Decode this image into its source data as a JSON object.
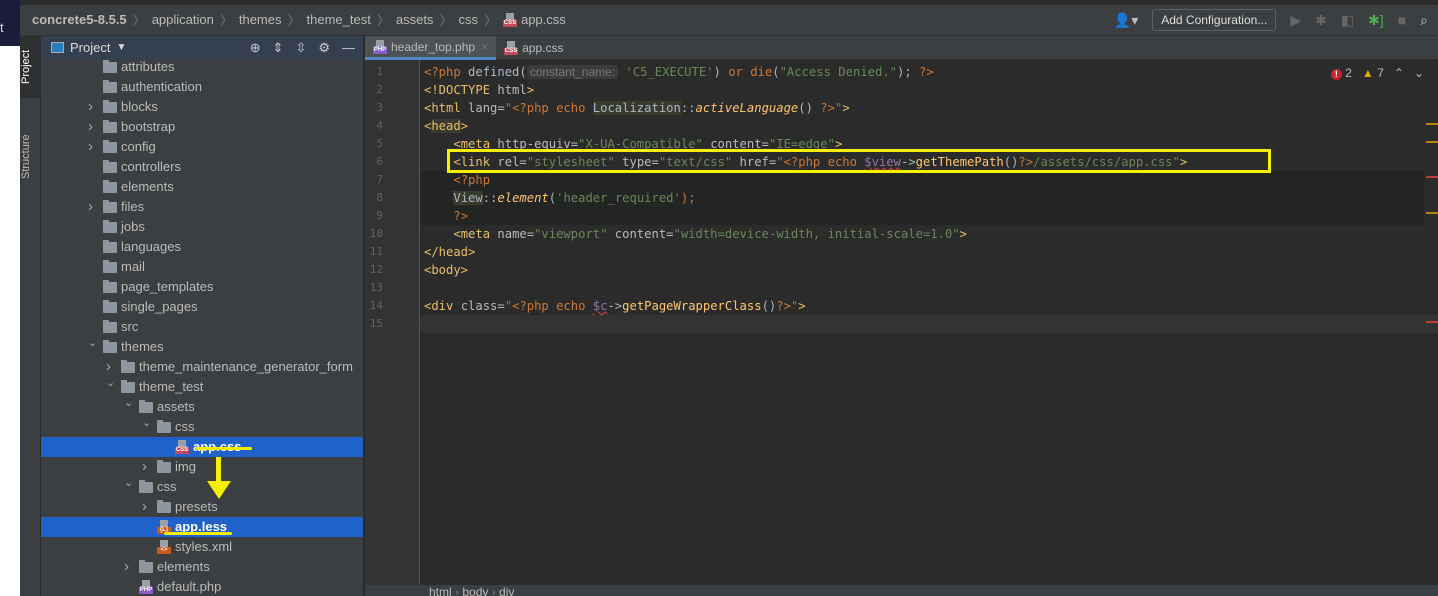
{
  "left_window": {
    "text": "t"
  },
  "breadcrumb": [
    "concrete5-8.5.5",
    "application",
    "themes",
    "theme_test",
    "assets",
    "css",
    "app.css"
  ],
  "toolbar": {
    "add_configuration": "Add Configuration...",
    "icons": [
      "user-icon",
      "run-icon",
      "debug-icon",
      "coverage-icon",
      "attach-debugger-icon",
      "stop-icon",
      "search-icon"
    ]
  },
  "tool_strip": {
    "project": "Project",
    "structure": "Structure"
  },
  "project_panel": {
    "title": "Project",
    "rows": [
      {
        "label": "attributes",
        "level": 1,
        "type": "folder",
        "arrow": ""
      },
      {
        "label": "authentication",
        "level": 1,
        "type": "folder",
        "arrow": ""
      },
      {
        "label": "blocks",
        "level": 1,
        "type": "folder",
        "arrow": "right"
      },
      {
        "label": "bootstrap",
        "level": 1,
        "type": "folder",
        "arrow": "right"
      },
      {
        "label": "config",
        "level": 1,
        "type": "folder",
        "arrow": "right"
      },
      {
        "label": "controllers",
        "level": 1,
        "type": "folder",
        "arrow": ""
      },
      {
        "label": "elements",
        "level": 1,
        "type": "folder",
        "arrow": ""
      },
      {
        "label": "files",
        "level": 1,
        "type": "folder",
        "arrow": "right"
      },
      {
        "label": "jobs",
        "level": 1,
        "type": "folder",
        "arrow": ""
      },
      {
        "label": "languages",
        "level": 1,
        "type": "folder",
        "arrow": ""
      },
      {
        "label": "mail",
        "level": 1,
        "type": "folder",
        "arrow": ""
      },
      {
        "label": "page_templates",
        "level": 1,
        "type": "folder",
        "arrow": ""
      },
      {
        "label": "single_pages",
        "level": 1,
        "type": "folder",
        "arrow": ""
      },
      {
        "label": "src",
        "level": 1,
        "type": "folder",
        "arrow": ""
      },
      {
        "label": "themes",
        "level": 1,
        "type": "folder",
        "arrow": "down"
      },
      {
        "label": "theme_maintenance_generator_form",
        "level": 2,
        "type": "folder",
        "arrow": "right"
      },
      {
        "label": "theme_test",
        "level": 2,
        "type": "folder",
        "arrow": "down"
      },
      {
        "label": "assets",
        "level": 3,
        "type": "folder",
        "arrow": "down"
      },
      {
        "label": "css",
        "level": 4,
        "type": "folder",
        "arrow": "down"
      },
      {
        "label": "app.css",
        "level": 5,
        "type": "css",
        "arrow": "",
        "selected": true
      },
      {
        "label": "img",
        "level": 4,
        "type": "folder",
        "arrow": "right"
      },
      {
        "label": "css",
        "level": 3,
        "type": "folder",
        "arrow": "down"
      },
      {
        "label": "presets",
        "level": 4,
        "type": "folder",
        "arrow": "right"
      },
      {
        "label": "app.less",
        "level": 4,
        "type": "less",
        "arrow": "",
        "selected": true
      },
      {
        "label": "styles.xml",
        "level": 4,
        "type": "xml",
        "arrow": ""
      },
      {
        "label": "elements",
        "level": 3,
        "type": "folder",
        "arrow": "right"
      },
      {
        "label": "default.php",
        "level": 3,
        "type": "php",
        "arrow": ""
      }
    ]
  },
  "file_badges": {
    "css": "CSS",
    "php": "PHP",
    "less": "{L}",
    "xml": "<>"
  },
  "tabs": [
    {
      "label": "header_top.php",
      "type": "php",
      "active": true
    },
    {
      "label": "app.css",
      "type": "css",
      "active": false
    }
  ],
  "inspections": {
    "errors": "2",
    "warnings": "7"
  },
  "editor": {
    "line_numbers": [
      "1",
      "2",
      "3",
      "4",
      "5",
      "6",
      "7",
      "8",
      "9",
      "10",
      "11",
      "12",
      "13",
      "14",
      "15"
    ],
    "lines": [
      [
        [
          "t-php",
          "<?php "
        ],
        [
          "t-plain",
          "defined("
        ],
        [
          "t-hint",
          "constant_name:"
        ],
        [
          "t-str",
          " 'C5_EXECUTE'"
        ],
        [
          "t-plain",
          ") "
        ],
        [
          "t-kw",
          "or "
        ],
        [
          "t-kw",
          "die"
        ],
        [
          "t-plain",
          "("
        ],
        [
          "t-str",
          "\"Access Denied.\""
        ],
        [
          "t-plain",
          "); "
        ],
        [
          "t-php",
          "?>"
        ]
      ],
      [
        [
          "t-tag",
          "<!DOCTYPE "
        ],
        [
          "t-attr",
          "html"
        ],
        [
          "t-tag",
          ">"
        ]
      ],
      [
        [
          "t-tag",
          "<html "
        ],
        [
          "t-attr",
          "lang="
        ],
        [
          "t-str",
          "\""
        ],
        [
          "t-php",
          "<?php echo "
        ],
        [
          "t-cls",
          "Localization"
        ],
        [
          "t-plain",
          "::"
        ],
        [
          "t-fn",
          "activeLanguage"
        ],
        [
          "t-plain",
          "() "
        ],
        [
          "t-php",
          "?>"
        ],
        [
          "t-str",
          "\""
        ],
        [
          "t-tag",
          ">"
        ]
      ],
      [
        [
          "t-tag",
          "<"
        ],
        [
          "t-tag t-hl",
          "head"
        ],
        [
          "t-tag",
          ">"
        ]
      ],
      [
        [
          "t-plain",
          "    "
        ],
        [
          "t-tag",
          "<meta "
        ],
        [
          "t-attr",
          "http-equiv="
        ],
        [
          "t-str",
          "\"X-UA-Compatible\" "
        ],
        [
          "t-attr",
          "content="
        ],
        [
          "t-str",
          "\"IE=edge\""
        ],
        [
          "t-tag",
          ">"
        ]
      ],
      [
        [
          "t-plain",
          "    "
        ],
        [
          "t-tag",
          "<link "
        ],
        [
          "t-attr",
          "rel="
        ],
        [
          "t-str",
          "\"stylesheet\" "
        ],
        [
          "t-attr",
          "type="
        ],
        [
          "t-str",
          "\"text/css\" "
        ],
        [
          "t-attr",
          "href="
        ],
        [
          "t-str",
          "\""
        ],
        [
          "t-php",
          "<?php echo "
        ],
        [
          "t-var",
          "$view"
        ],
        [
          "t-plain",
          "->"
        ],
        [
          "t-call",
          "getThemePath"
        ],
        [
          "t-plain",
          "()"
        ],
        [
          "t-php",
          "?>"
        ],
        [
          "t-str",
          "/assets/css/app.css\""
        ],
        [
          "t-tag",
          ">"
        ]
      ],
      [
        [
          "t-plain",
          "    "
        ],
        [
          "t-php",
          "<?php"
        ]
      ],
      [
        [
          "t-plain",
          "    "
        ],
        [
          "t-cls",
          "View"
        ],
        [
          "t-plain",
          "::"
        ],
        [
          "t-fn",
          "element"
        ],
        [
          "t-plain",
          "("
        ],
        [
          "t-str",
          "'header_required'"
        ],
        [
          "t-php",
          ");"
        ]
      ],
      [
        [
          "t-plain",
          "    "
        ],
        [
          "t-php",
          "?>"
        ]
      ],
      [
        [
          "t-plain",
          "    "
        ],
        [
          "t-tag",
          "<meta "
        ],
        [
          "t-attr",
          "name="
        ],
        [
          "t-str",
          "\"viewport\" "
        ],
        [
          "t-attr",
          "content="
        ],
        [
          "t-str",
          "\"width=device-width, initial-scale=1.0\""
        ],
        [
          "t-tag",
          ">"
        ]
      ],
      [
        [
          "t-tag",
          "</head>"
        ]
      ],
      [
        [
          "t-tag",
          "<body>"
        ]
      ],
      [],
      [
        [
          "t-tag",
          "<div "
        ],
        [
          "t-attr",
          "class="
        ],
        [
          "t-str",
          "\""
        ],
        [
          "t-php",
          "<?php echo "
        ],
        [
          "t-var",
          "$c"
        ],
        [
          "t-plain",
          "->"
        ],
        [
          "t-call",
          "getPageWrapperClass"
        ],
        [
          "t-plain",
          "()"
        ],
        [
          "t-php",
          "?>"
        ],
        [
          "t-str",
          "\""
        ],
        [
          "t-tag",
          ">"
        ]
      ],
      []
    ]
  },
  "status_breadcrumb": [
    "html",
    "body",
    "div"
  ],
  "colors": {
    "selection": "#2062c9",
    "annotation": "#f6f000",
    "editor_bg": "#2b2b2b",
    "panel_bg": "#3c3f41"
  }
}
